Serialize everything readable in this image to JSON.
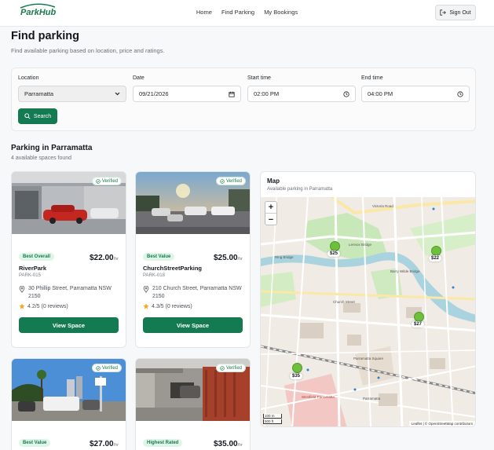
{
  "app": {
    "logo": "ParkHub"
  },
  "nav": {
    "items": [
      "Home",
      "Find Parking",
      "My Bookings"
    ],
    "signout": "Sign Out"
  },
  "page": {
    "title": "Find parking",
    "subtitle": "Find available parking based on location, price and ratings."
  },
  "filters": {
    "location_label": "Location",
    "location_value": "Parramatta",
    "date_label": "Date",
    "date_value": "09/21/2026",
    "start_label": "Start time",
    "start_value": "02:00 PM",
    "end_label": "End time",
    "end_value": "04:00 PM",
    "search_label": "Search"
  },
  "results": {
    "title": "Parking in Parramatta",
    "count": "4 available spaces found",
    "verified_label": "Verified",
    "view_label": "View Space",
    "per_hr": "/hr",
    "cards": [
      {
        "badge": "Best Overall",
        "price": "$22.00",
        "name": "RiverPark",
        "id": "PARK-015",
        "address": "30 Phillip Street, Parramatta NSW 2150",
        "rating": "4.2/5 (0 reviews)"
      },
      {
        "badge": "Best Value",
        "price": "$25.00",
        "name": "ChurchStreetParking",
        "id": "PARK-018",
        "address": "210 Church Street, Parramatta NSW 2150",
        "rating": "4.3/5 (0 reviews)"
      },
      {
        "badge": "Best Value",
        "price": "$27.00"
      },
      {
        "badge": "Highest Rated",
        "price": "$35.00"
      }
    ]
  },
  "map": {
    "title": "Map",
    "subtitle": "Available parking in Parramatta",
    "zoom_in": "+",
    "zoom_out": "−",
    "pins": [
      "$25",
      "$22",
      "$27",
      "$35"
    ],
    "street_labels": [
      "Victoria Road",
      "Ring Bridge",
      "Lennox Bridge",
      "Barry Wilde Bridge",
      "Church Street",
      "Parramatta Square",
      "Westfield Parramatta",
      "Parramatta"
    ],
    "attribution": "Leaflet | © OpenStreetMap contributors",
    "scale_top": "100 m",
    "scale_bottom": "500 ft"
  },
  "colors": {
    "brand": "#137a51",
    "badge_bg": "#dff5e8",
    "pin": "#6fbf3e",
    "star": "#f5a623"
  }
}
